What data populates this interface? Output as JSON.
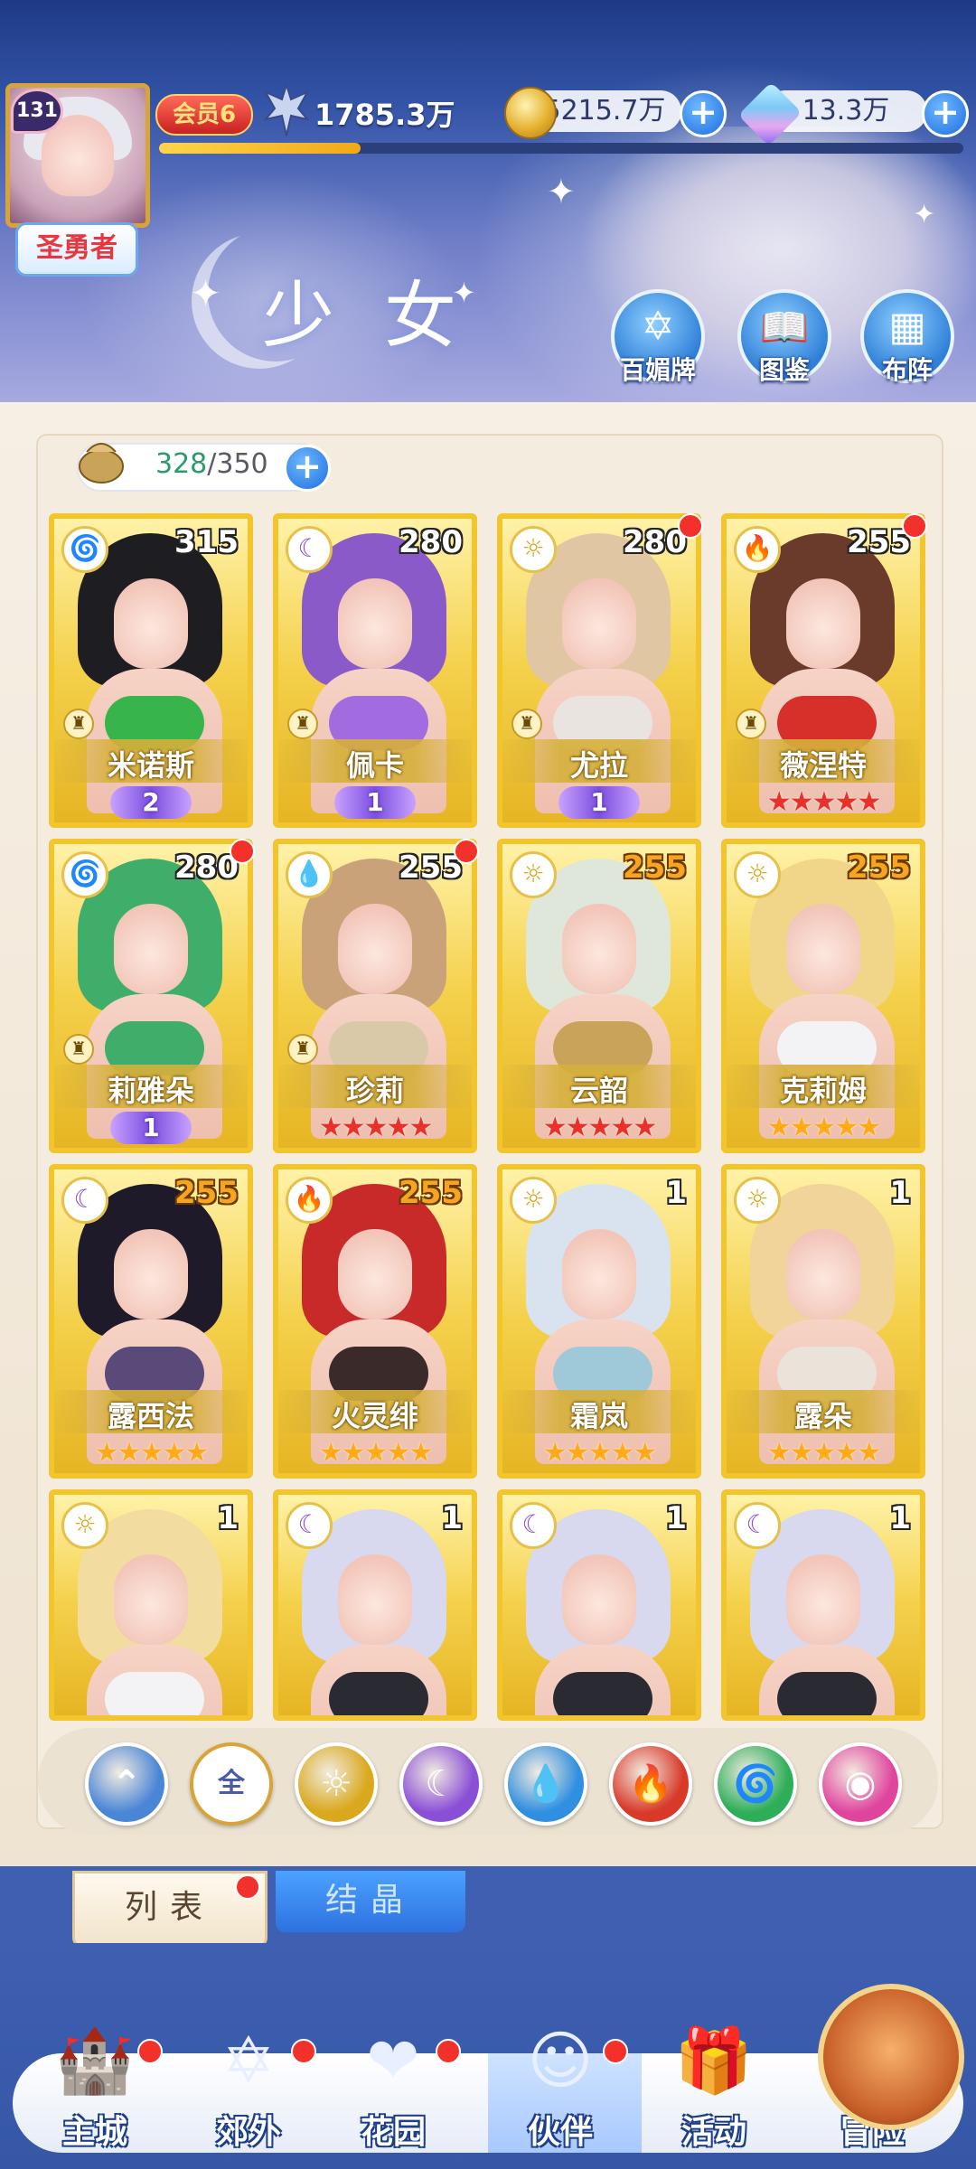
{
  "header": {
    "player_level": "131",
    "player_title": "圣勇者",
    "vip_label": "会员6",
    "power": "1785.3万",
    "exp_fraction": 0.25,
    "gold": "5215.7万",
    "diamond": "13.3万",
    "page_title": "少女",
    "buttons": [
      {
        "label": "百媚牌",
        "icon": "card-icon"
      },
      {
        "label": "图鉴",
        "icon": "book-icon"
      },
      {
        "label": "布阵",
        "icon": "formation-grid-icon"
      }
    ]
  },
  "capacity": {
    "current": "328",
    "separator": "/",
    "max": "350"
  },
  "cards": [
    {
      "name": "米诺斯",
      "level": "315",
      "element": "wind",
      "rank": "wings",
      "rank_value": "2",
      "red_dot": false,
      "chess": true
    },
    {
      "name": "佩卡",
      "level": "280",
      "element": "dark",
      "rank": "wings",
      "rank_value": "1",
      "red_dot": false,
      "chess": true
    },
    {
      "name": "尤拉",
      "level": "280",
      "element": "light",
      "rank": "wings",
      "rank_value": "1",
      "red_dot": true,
      "chess": true
    },
    {
      "name": "薇涅特",
      "level": "255",
      "element": "fire",
      "rank": "stars-red",
      "rank_value": "★★★★★",
      "red_dot": true,
      "chess": true
    },
    {
      "name": "莉雅朵",
      "level": "280",
      "element": "wind",
      "rank": "wings",
      "rank_value": "1",
      "red_dot": true,
      "chess": true
    },
    {
      "name": "珍莉",
      "level": "255",
      "element": "water",
      "rank": "stars-red",
      "rank_value": "★★★★★",
      "red_dot": true,
      "chess": true
    },
    {
      "name": "云韶",
      "level": "255",
      "element": "light",
      "rank": "stars-red",
      "rank_value": "★★★★★",
      "red_dot": false,
      "chess": false,
      "gold_level": true
    },
    {
      "name": "克莉姆",
      "level": "255",
      "element": "light",
      "rank": "stars-gold",
      "rank_value": "★★★★★",
      "red_dot": false,
      "chess": false,
      "gold_level": true
    },
    {
      "name": "露西法",
      "level": "255",
      "element": "dark",
      "rank": "stars-gold",
      "rank_value": "★★★★★",
      "red_dot": false,
      "chess": false,
      "gold_level": true
    },
    {
      "name": "火灵绯",
      "level": "255",
      "element": "fire",
      "rank": "stars-gold",
      "rank_value": "★★★★★",
      "red_dot": false,
      "chess": false,
      "gold_level": true
    },
    {
      "name": "霜岚",
      "level": "1",
      "element": "light",
      "rank": "stars-gold",
      "rank_value": "★★★★★",
      "red_dot": false,
      "chess": false
    },
    {
      "name": "露朵",
      "level": "1",
      "element": "light",
      "rank": "stars-gold",
      "rank_value": "★★★★★",
      "red_dot": false,
      "chess": false
    },
    {
      "name": "",
      "level": "1",
      "element": "light",
      "rank": "none",
      "rank_value": "",
      "red_dot": false,
      "chess": false
    },
    {
      "name": "",
      "level": "1",
      "element": "dark",
      "rank": "none",
      "rank_value": "",
      "red_dot": false,
      "chess": false
    },
    {
      "name": "",
      "level": "1",
      "element": "dark",
      "rank": "none",
      "rank_value": "",
      "red_dot": false,
      "chess": false
    },
    {
      "name": "",
      "level": "1",
      "element": "dark",
      "rank": "none",
      "rank_value": "",
      "red_dot": false,
      "chess": false
    }
  ],
  "filters": [
    {
      "id": "sort",
      "icon": "sort-icon",
      "label": ""
    },
    {
      "id": "all",
      "icon": "all-icon",
      "label": "全"
    },
    {
      "id": "light",
      "icon": "sun-icon",
      "label": ""
    },
    {
      "id": "dark",
      "icon": "moon-icon",
      "label": ""
    },
    {
      "id": "water",
      "icon": "water-icon",
      "label": ""
    },
    {
      "id": "fire",
      "icon": "fire-icon",
      "label": ""
    },
    {
      "id": "wind",
      "icon": "wind-icon",
      "label": ""
    },
    {
      "id": "special",
      "icon": "orb-icon",
      "label": ""
    }
  ],
  "tabs": {
    "list": "列表",
    "crystal": "结晶"
  },
  "nav": [
    {
      "label": "主城",
      "icon": "castle-icon",
      "red_dot": true
    },
    {
      "label": "郊外",
      "icon": "portal-icon",
      "red_dot": true
    },
    {
      "label": "花园",
      "icon": "heart-icon",
      "red_dot": true
    },
    {
      "label": "伙伴",
      "icon": "partner-icon",
      "red_dot": true,
      "active": true
    },
    {
      "label": "活动",
      "icon": "gift-icon",
      "red_dot": false
    },
    {
      "label": "冒险",
      "icon": "compass-icon",
      "red_dot": false
    }
  ],
  "colors": {
    "light": "#d9a81c",
    "dark": "#8b4fd6",
    "water": "#2f8fe0",
    "fire": "#d83a2a",
    "wind": "#2fae5a",
    "special": "#e0459e",
    "sort": "#4a86d6"
  }
}
